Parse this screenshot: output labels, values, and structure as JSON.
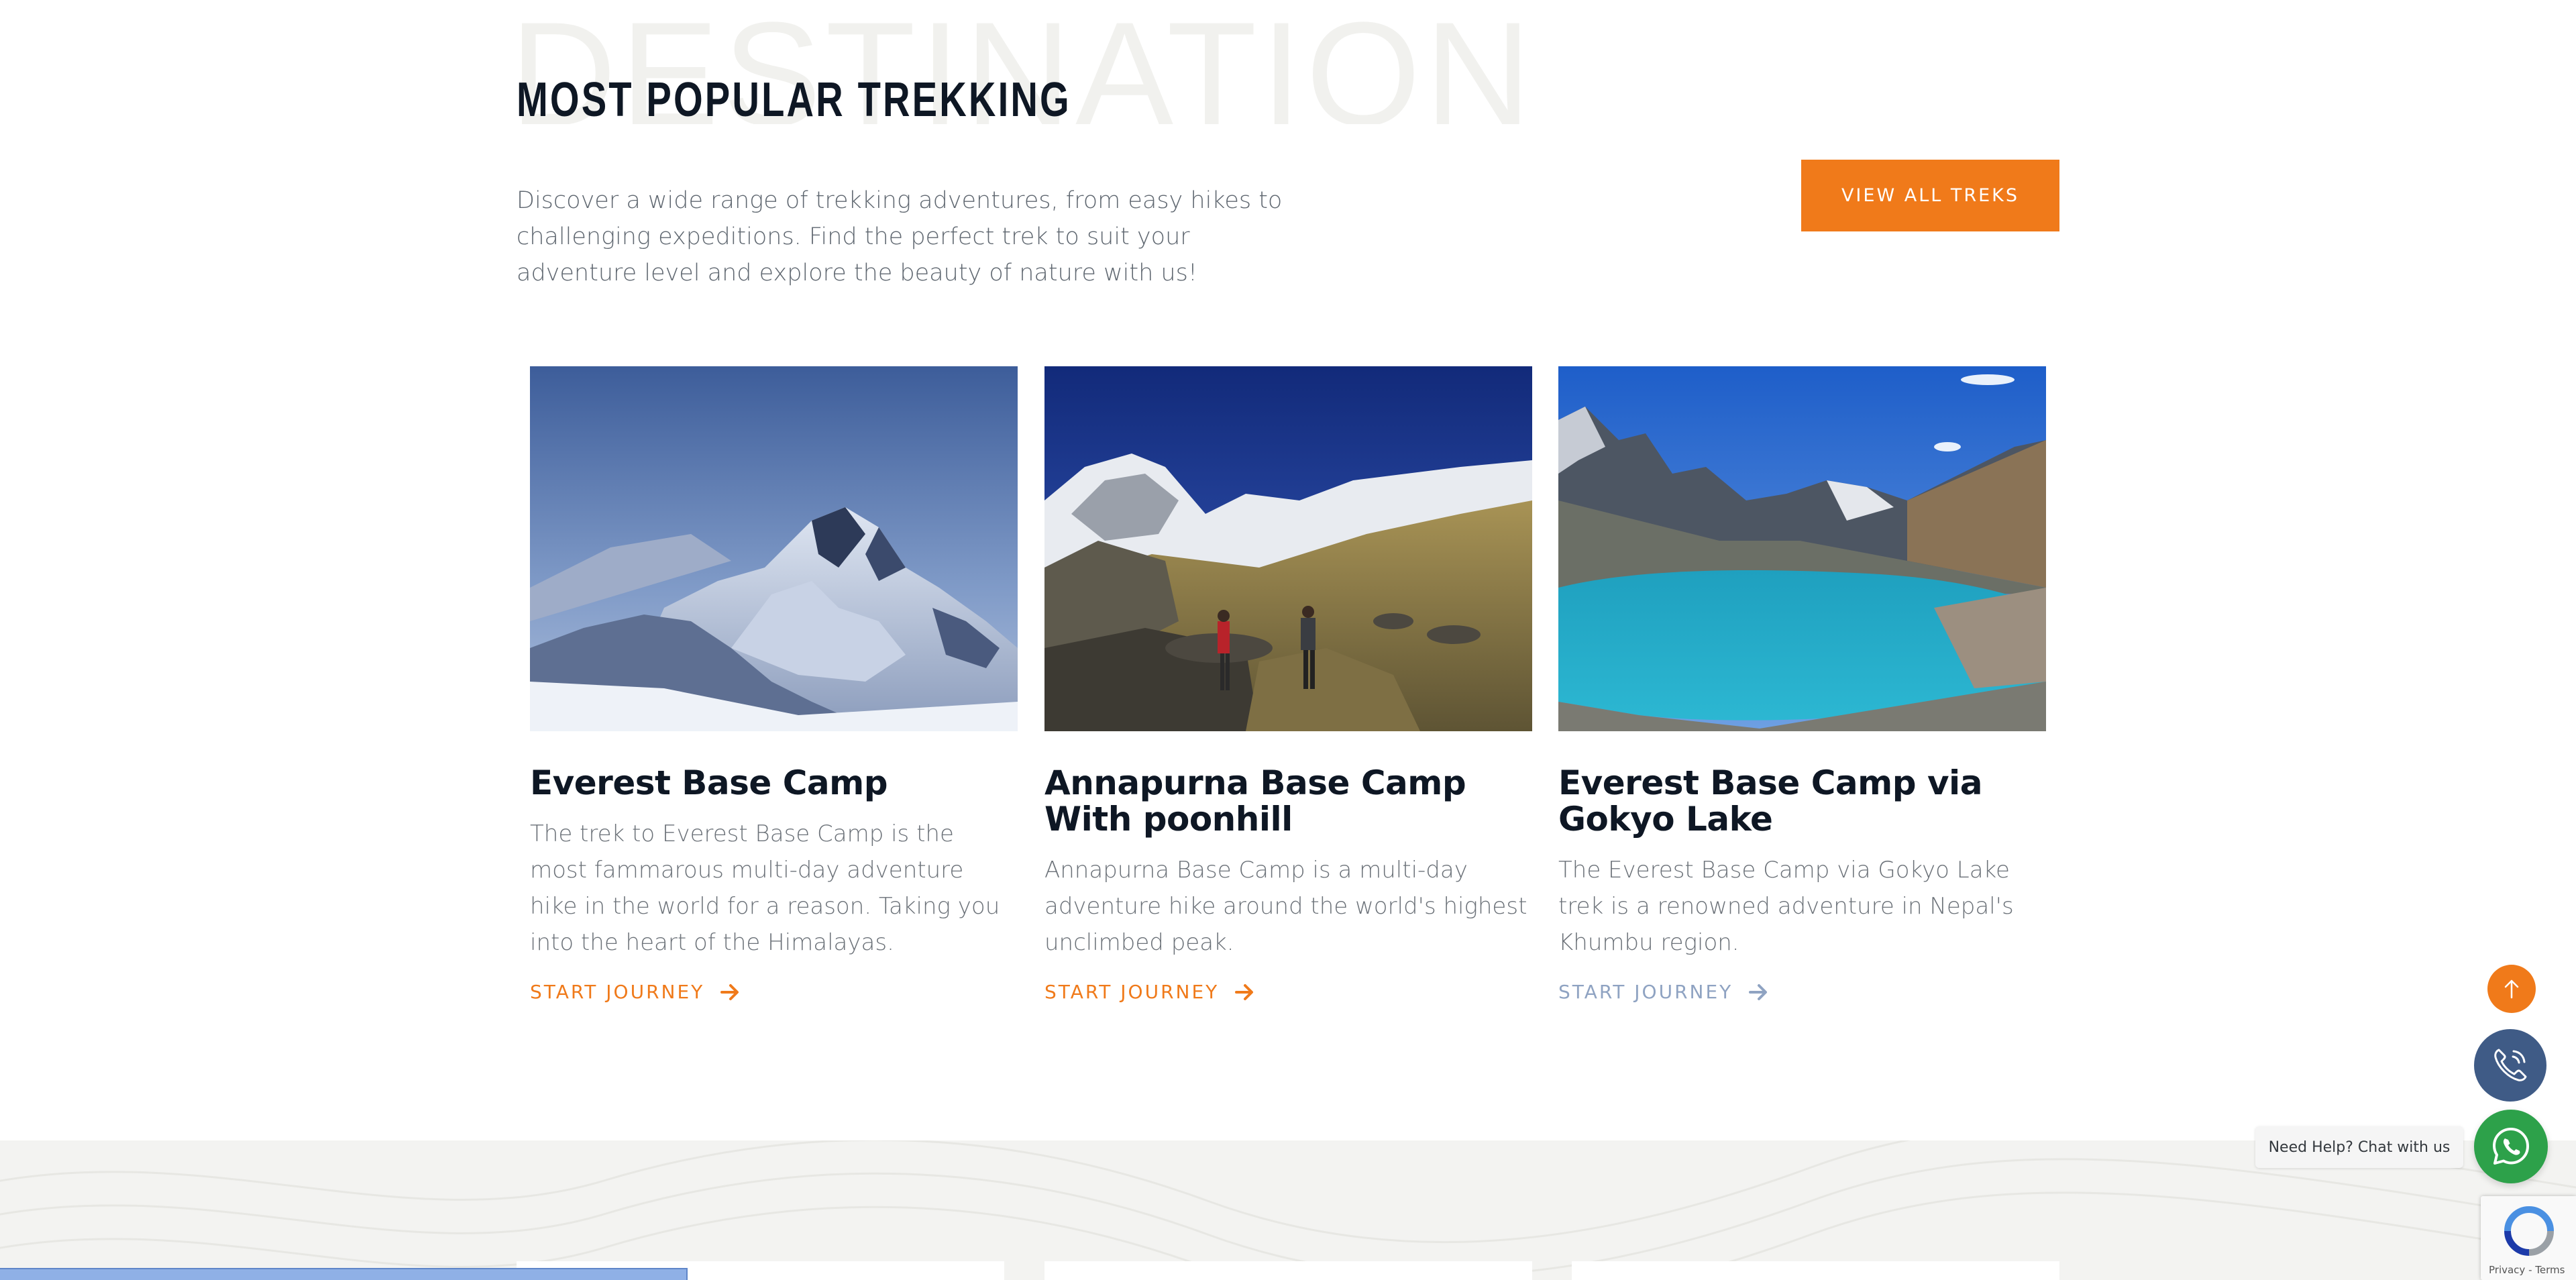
{
  "section": {
    "background_word": "DESTINATION",
    "title": "MOST POPULAR TREKKING",
    "intro": "Discover a wide range of trekking adventures, from easy hikes to challenging expeditions. Find the perfect trek to suit your adventure level and explore the beauty of nature with us!",
    "view_all_label": "VIEW ALL TREKS"
  },
  "cards": [
    {
      "title": "Everest Base Camp",
      "description": "The trek to Everest Base Camp is the most fammarous multi-day adventure hike in the world for a reason. Taking you into the heart of the Himalayas.",
      "cta": "START JOURNEY",
      "image": "snowy-everest-peak-photo"
    },
    {
      "title": "Annapurna Base Camp With poonhill",
      "description": "Annapurna Base Camp is a multi-day adventure hike around the world's highest unclimbed peak.",
      "cta": "START JOURNEY",
      "image": "annapurna-trekkers-valley-photo"
    },
    {
      "title": "Everest Base Camp via Gokyo Lake",
      "description": "The Everest Base Camp via Gokyo Lake trek is a renowned adventure in Nepal's Khumbu region.",
      "cta": "START JOURNEY",
      "image": "gokyo-turquoise-lake-photo"
    }
  ],
  "floating": {
    "chat_label": "Need Help? Chat with us",
    "recaptcha_links": "Privacy - Terms"
  },
  "colors": {
    "accent": "#f07a1a",
    "heading": "#0e1724",
    "body_text": "#6b7178",
    "phone_button": "#3f5b86",
    "whatsapp_button": "#2da14a",
    "muted_cta": "#8fa3c2"
  }
}
